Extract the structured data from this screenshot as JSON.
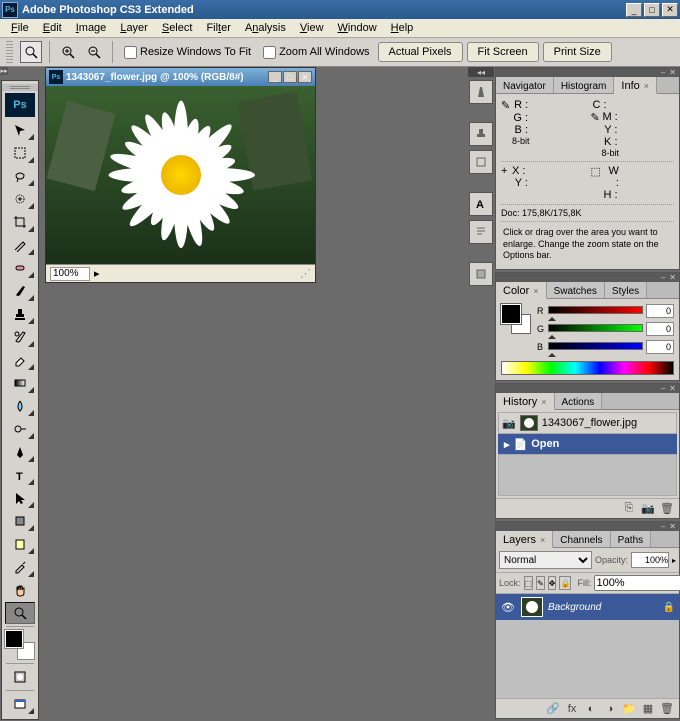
{
  "app": {
    "title": "Adobe Photoshop CS3 Extended"
  },
  "menu": [
    "File",
    "Edit",
    "Image",
    "Layer",
    "Select",
    "Filter",
    "Analysis",
    "View",
    "Window",
    "Help"
  ],
  "optbar": {
    "resize_label": "Resize Windows To Fit",
    "zoom_all_label": "Zoom All Windows",
    "actual_pixels": "Actual Pixels",
    "fit_screen": "Fit Screen",
    "print_size": "Print Size"
  },
  "document": {
    "title": "1343067_flower.jpg @ 100% (RGB/8#)",
    "filename": "1343067_flower.jpg",
    "zoom": "100%"
  },
  "panels": {
    "nav_tabs": [
      "Navigator",
      "Histogram",
      "Info"
    ],
    "info": {
      "r": "R :",
      "g": "G :",
      "b": "B :",
      "c": "C :",
      "m": "M :",
      "y": "Y :",
      "k": "K :",
      "bit": "8-bit",
      "x": "X :",
      "yy": "Y :",
      "w": "W :",
      "h": "H :",
      "doc": "Doc: 175,8K/175,8K",
      "hint": "Click or drag over the area you want to enlarge. Change the zoom state on the Options bar."
    },
    "color_tabs": [
      "Color",
      "Swatches",
      "Styles"
    ],
    "color": {
      "r": "R",
      "g": "G",
      "b": "B",
      "rv": "0",
      "gv": "0",
      "bv": "0"
    },
    "history_tabs": [
      "History",
      "Actions"
    ],
    "history": {
      "open": "Open"
    },
    "layers_tabs": [
      "Layers",
      "Channels",
      "Paths"
    ],
    "layers": {
      "blend": "Normal",
      "opacity_lbl": "Opacity:",
      "opacity_val": "100%",
      "lock_lbl": "Lock:",
      "fill_lbl": "Fill:",
      "fill_val": "100%",
      "bg_layer": "Background"
    }
  }
}
